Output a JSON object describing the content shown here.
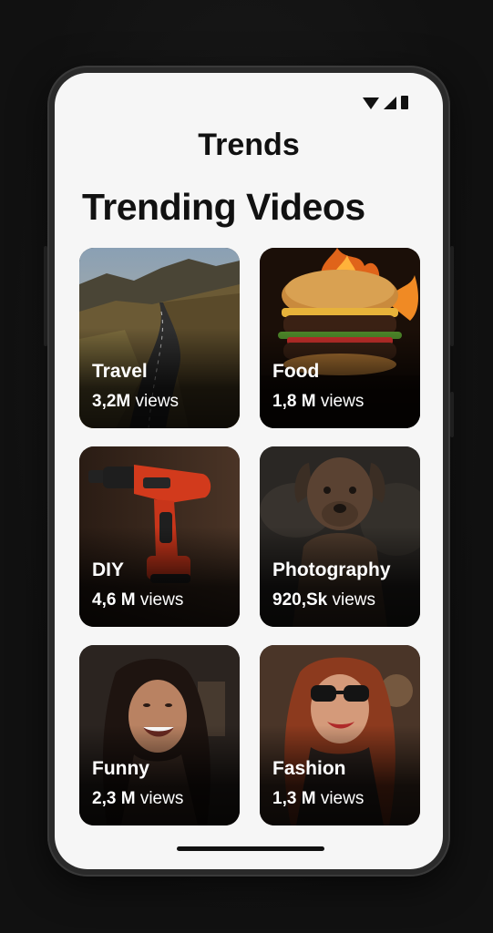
{
  "screen": {
    "title": "Trends",
    "heading": "Trending Videos"
  },
  "status_bar": {
    "icons": [
      "wifi-icon",
      "signal-icon",
      "battery-icon"
    ]
  },
  "cards": [
    {
      "label": "Travel",
      "views_value": "3,2M",
      "views_unit": "views",
      "thumbnail": "winding-mountain-road"
    },
    {
      "label": "Food",
      "views_value": "1,8 M",
      "views_unit": "views",
      "thumbnail": "burger-with-flames"
    },
    {
      "label": "DIY",
      "views_value": "4,6 M",
      "views_unit": "views",
      "thumbnail": "red-power-drill"
    },
    {
      "label": "Photography",
      "views_value": "920,Sk",
      "views_unit": "views",
      "thumbnail": "brown-dog-portrait"
    },
    {
      "label": "Funny",
      "views_value": "2,3 M",
      "views_unit": "views",
      "thumbnail": "laughing-woman"
    },
    {
      "label": "Fashion",
      "views_value": "1,3 M",
      "views_unit": "views",
      "thumbnail": "woman-in-sunglasses"
    }
  ],
  "colors": {
    "screen_bg": "#f6f6f6",
    "text_dark": "#111111",
    "card_text": "#ffffff"
  }
}
